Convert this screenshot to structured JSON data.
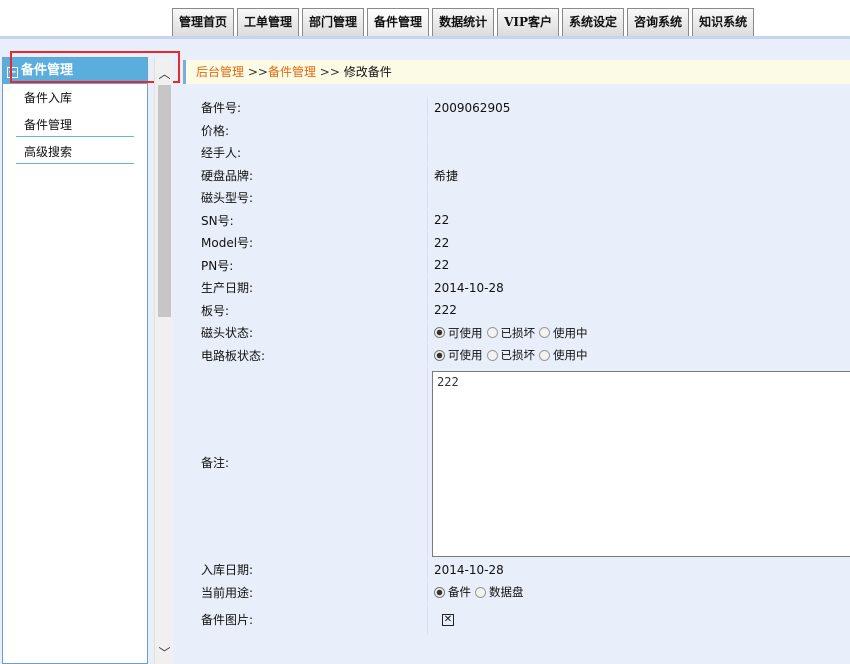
{
  "nav": {
    "tabs": [
      {
        "label": "管理首页"
      },
      {
        "label": "工单管理"
      },
      {
        "label": "部门管理"
      },
      {
        "label": "备件管理",
        "active": true
      },
      {
        "label": "数据统计"
      },
      {
        "label": "VIP客户"
      },
      {
        "label": "系统设定"
      },
      {
        "label": "咨询系统"
      },
      {
        "label": "知识系统"
      }
    ]
  },
  "sidebar": {
    "title": "备件管理",
    "items": [
      {
        "label": "备件入库"
      },
      {
        "label": "备件管理"
      },
      {
        "label": "高级搜索"
      }
    ]
  },
  "breadcrumb": {
    "home": "后台管理",
    "sep1": ">>",
    "section": "备件管理",
    "sep2": ">>",
    "current": "修改备件"
  },
  "form": {
    "part_no": {
      "label": "备件号:",
      "value": "2009062905"
    },
    "price": {
      "label": "价格:",
      "value": ""
    },
    "handler": {
      "label": "经手人:",
      "value": ""
    },
    "disk_brand": {
      "label": "硬盘品牌:",
      "value": "希捷"
    },
    "head_model": {
      "label": "磁头型号:",
      "value": ""
    },
    "sn": {
      "label": "SN号:",
      "value": "22"
    },
    "model": {
      "label": "Model号:",
      "value": "22"
    },
    "pn": {
      "label": "PN号:",
      "value": "22"
    },
    "mfg_date": {
      "label": "生产日期:",
      "value": "2014-10-28"
    },
    "board_no": {
      "label": "板号:",
      "value": "222"
    },
    "head_status": {
      "label": "磁头状态:",
      "options": [
        "可使用",
        "已损坏",
        "使用中"
      ],
      "selected": "可使用"
    },
    "board_status": {
      "label": "电路板状态:",
      "options": [
        "可使用",
        "已损坏",
        "使用中"
      ],
      "selected": "可使用"
    },
    "notes": {
      "label": "备注:",
      "value": "222"
    },
    "stock_date": {
      "label": "入库日期:",
      "value": "2014-10-28"
    },
    "usage": {
      "label": "当前用途:",
      "options": [
        "备件",
        "数据盘"
      ],
      "selected": "备件"
    },
    "image": {
      "label": "备件图片:",
      "icon": "broken-image-icon"
    }
  }
}
